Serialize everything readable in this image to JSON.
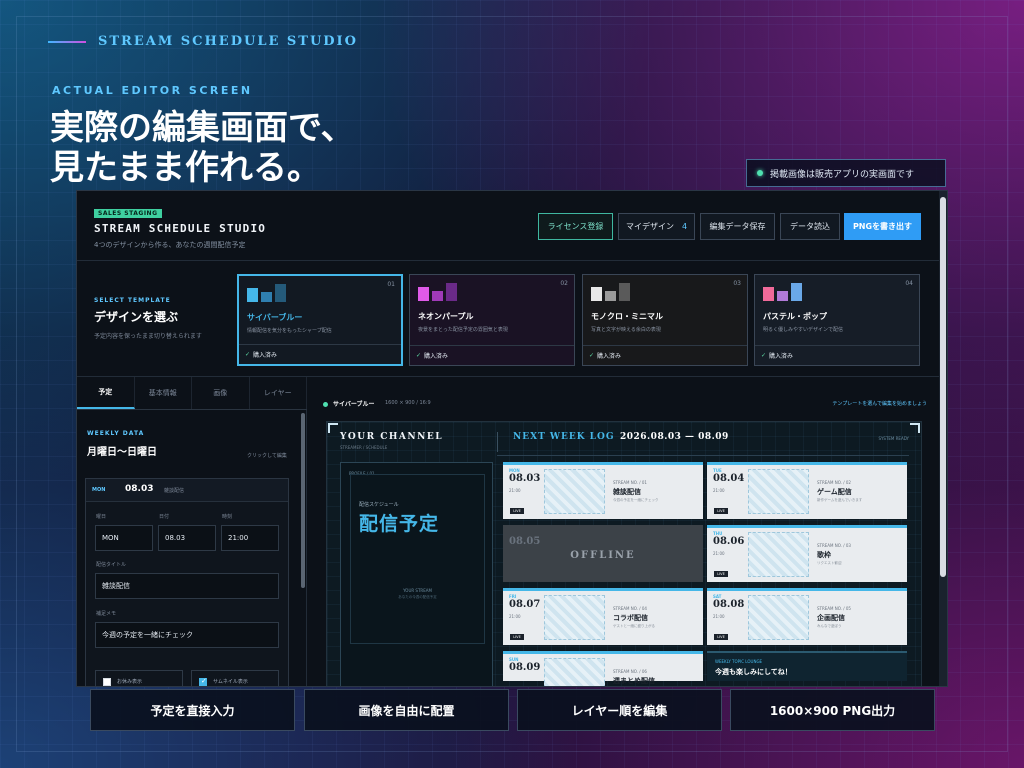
{
  "brand": "STREAM SCHEDULE STUDIO",
  "eyebrow": "ACTUAL EDITOR SCREEN",
  "headline": [
    "実際の編集画面で、",
    "見たまま作れる。"
  ],
  "notice": "掲載画像は販売アプリの実画面です",
  "app": {
    "staging_badge": "SALES STAGING",
    "title": "STREAM SCHEDULE STUDIO",
    "subtitle": "4つのデザインから作る、あなたの週間配信予定",
    "buttons": {
      "license": "ライセンス登録",
      "my_design": "マイデザイン",
      "my_design_count": "4",
      "save": "編集データ保存",
      "load": "データ読込",
      "export": "PNGを書き出す"
    },
    "templates": {
      "eyebrow": "SELECT TEMPLATE",
      "heading": "デザインを選ぶ",
      "desc": "予定内容を保ったまま切り替えられます",
      "items": [
        {
          "num": "01",
          "name": "サイバーブルー",
          "desc": "情報配信を気分をもったシャープ配信",
          "bought": "購入済み",
          "name_color": "#45b7e8",
          "swatches": [
            "#45b7e8",
            "#2f7fb0",
            "#245a7a"
          ]
        },
        {
          "num": "02",
          "name": "ネオンパープル",
          "desc": "夜景をまとった配信予定の雰囲気と表現",
          "bought": "購入済み",
          "name_color": "#ffffff",
          "swatches": [
            "#e05ae8",
            "#a03ab8",
            "#6a2a88"
          ]
        },
        {
          "num": "03",
          "name": "モノクロ・ミニマル",
          "desc": "写真と文字が映える余白の表現",
          "bought": "購入済み",
          "name_color": "#ffffff",
          "swatches": [
            "#e8e8e8",
            "#9a9a9a",
            "#5a5a5a"
          ]
        },
        {
          "num": "04",
          "name": "パステル・ポップ",
          "desc": "明るく優しみやすいデザインで配信",
          "bought": "購入済み",
          "name_color": "#ffffff",
          "swatches": [
            "#f06a9a",
            "#b07ad8",
            "#6aa8e8"
          ]
        }
      ]
    },
    "tabs": [
      "予定",
      "基本情報",
      "画像",
      "レイヤー"
    ],
    "weekly": {
      "eyebrow": "WEEKLY DATA",
      "title": "月曜日〜日曜日",
      "hint": "クリックして編集",
      "day_badge": "MON",
      "day_date": "08.03",
      "day_note": "雑談配信",
      "labels": {
        "weekday": "曜日",
        "date": "日付",
        "time": "時刻",
        "title": "配信タイトル",
        "memo": "補足メモ"
      },
      "values": {
        "weekday": "MON",
        "date": "08.03",
        "time": "21:00",
        "title": "雑談配信",
        "memo": "今週の予定を一緒にチェック"
      },
      "checks": [
        {
          "label": "お休み表示",
          "on": false
        },
        {
          "label": "サムネイル表示",
          "on": true
        }
      ]
    },
    "preview": {
      "name": "サイバーブルー",
      "size": "1600 × 900 / 16:9",
      "hint": "テンプレートを選んで編集を始めましょう",
      "canvas": {
        "channel": "YOUR CHANNEL",
        "channel_sub": "STREAMER / SCHEDULE",
        "next": "NEXT WEEK LOG",
        "range": "2026.08.03 — 08.09",
        "status": "SYSTEM READY",
        "poster": {
          "tag": "PROFILE / 01",
          "sub": "配信スケジュール",
          "big": "配信予定",
          "channel": "YOUR STREAM",
          "note": "あなたの今週の配信予定"
        },
        "slots": [
          {
            "day": "MON",
            "date": "08.03",
            "time": "21:00",
            "cat": "STREAM NO. / 01",
            "title": "雑談配信",
            "desc": "今週の予定を一緒にチェック",
            "mark": "LIVE"
          },
          {
            "day": "TUE",
            "date": "08.04",
            "time": "21:00",
            "cat": "STREAM NO. / 02",
            "title": "ゲーム配信",
            "desc": "新作ゲームを遊んでいきます",
            "mark": "LIVE"
          },
          {
            "day": "WED",
            "date": "08.05",
            "off": "OFFLINE"
          },
          {
            "day": "THU",
            "date": "08.06",
            "time": "21:00",
            "cat": "STREAM NO. / 03",
            "title": "歌枠",
            "desc": "リクエスト歓迎",
            "mark": "LIVE"
          },
          {
            "day": "FRI",
            "date": "08.07",
            "time": "21:00",
            "cat": "STREAM NO. / 04",
            "title": "コラボ配信",
            "desc": "ゲストと一緒に盛り上がる",
            "mark": "LIVE"
          },
          {
            "day": "SAT",
            "date": "08.08",
            "time": "21:00",
            "cat": "STREAM NO. / 05",
            "title": "企画配信",
            "desc": "みんなで遊ぼう",
            "mark": "LIVE"
          },
          {
            "day": "SUN",
            "date": "08.09",
            "cat": "STREAM NO. / 06",
            "title": "週まとめ配信"
          },
          {
            "cat": "WEEKLY TOPIC LOUNGE",
            "title": "今週も楽しみにしてね！"
          }
        ]
      }
    }
  },
  "features": [
    "予定を直接入力",
    "画像を自由に配置",
    "レイヤー順を編集",
    "1600×900 PNG出力"
  ]
}
